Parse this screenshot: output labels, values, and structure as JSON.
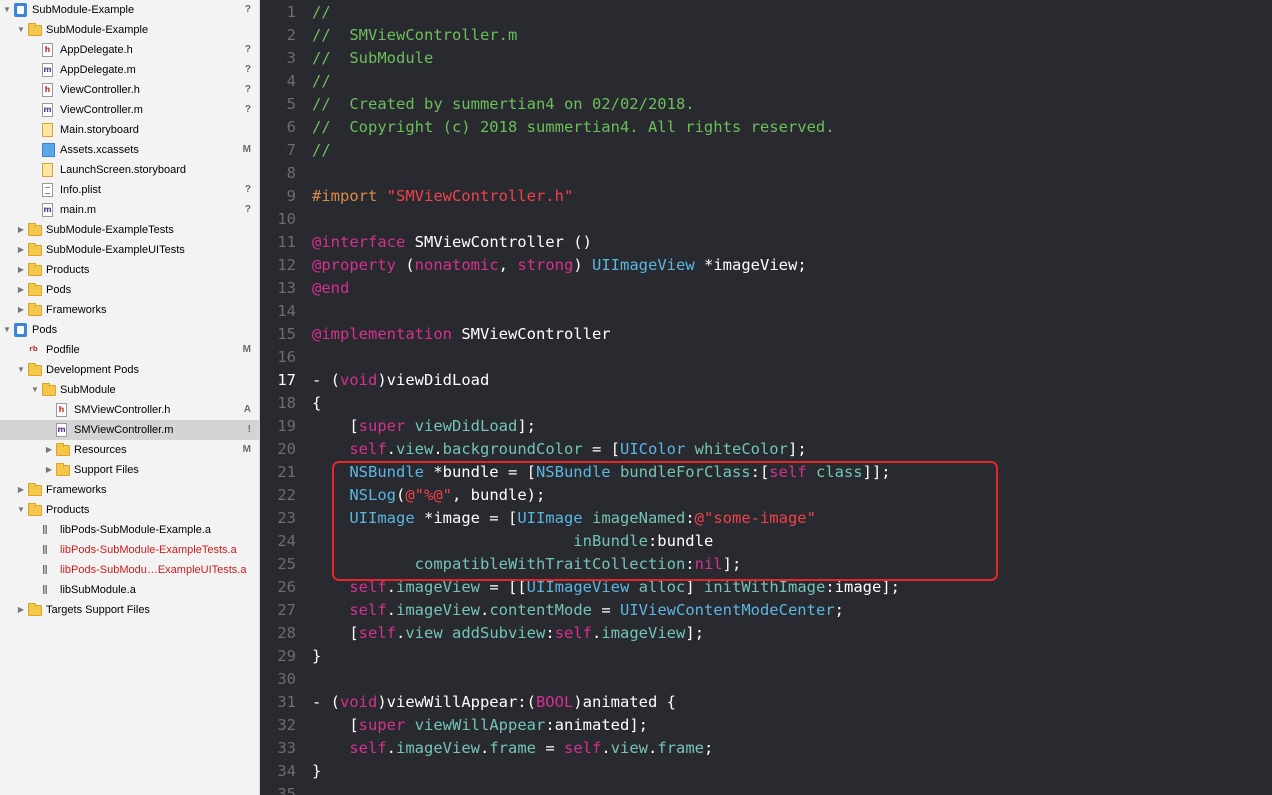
{
  "navigator": {
    "items": [
      {
        "label": "SubModule-Example",
        "depth": 0,
        "icon": "project-icon",
        "disclosure": "open",
        "status": "?"
      },
      {
        "label": "SubModule-Example",
        "depth": 1,
        "icon": "folder-icon",
        "disclosure": "open",
        "status": ""
      },
      {
        "label": "AppDelegate.h",
        "depth": 2,
        "icon": "header-file-icon",
        "disclosure": "",
        "status": "?"
      },
      {
        "label": "AppDelegate.m",
        "depth": 2,
        "icon": "objc-file-icon",
        "disclosure": "",
        "status": "?"
      },
      {
        "label": "ViewController.h",
        "depth": 2,
        "icon": "header-file-icon",
        "disclosure": "",
        "status": "?"
      },
      {
        "label": "ViewController.m",
        "depth": 2,
        "icon": "objc-file-icon",
        "disclosure": "",
        "status": "?"
      },
      {
        "label": "Main.storyboard",
        "depth": 2,
        "icon": "storyboard-icon",
        "disclosure": "",
        "status": ""
      },
      {
        "label": "Assets.xcassets",
        "depth": 2,
        "icon": "asset-catalog-icon",
        "disclosure": "",
        "status": "M"
      },
      {
        "label": "LaunchScreen.storyboard",
        "depth": 2,
        "icon": "storyboard-icon",
        "disclosure": "",
        "status": ""
      },
      {
        "label": "Info.plist",
        "depth": 2,
        "icon": "plist-icon",
        "disclosure": "",
        "status": "?"
      },
      {
        "label": "main.m",
        "depth": 2,
        "icon": "objc-file-icon",
        "disclosure": "",
        "status": "?"
      },
      {
        "label": "SubModule-ExampleTests",
        "depth": 1,
        "icon": "folder-icon",
        "disclosure": "closed",
        "status": ""
      },
      {
        "label": "SubModule-ExampleUITests",
        "depth": 1,
        "icon": "folder-icon",
        "disclosure": "closed",
        "status": ""
      },
      {
        "label": "Products",
        "depth": 1,
        "icon": "folder-icon",
        "disclosure": "closed",
        "status": ""
      },
      {
        "label": "Pods",
        "depth": 1,
        "icon": "folder-icon",
        "disclosure": "closed",
        "status": ""
      },
      {
        "label": "Frameworks",
        "depth": 1,
        "icon": "folder-icon",
        "disclosure": "closed",
        "status": ""
      },
      {
        "label": "Pods",
        "depth": 0,
        "icon": "project-icon",
        "disclosure": "open",
        "status": ""
      },
      {
        "label": "Podfile",
        "depth": 1,
        "icon": "ruby-file-icon",
        "disclosure": "",
        "status": "M"
      },
      {
        "label": "Development Pods",
        "depth": 1,
        "icon": "folder-icon",
        "disclosure": "open",
        "status": ""
      },
      {
        "label": "SubModule",
        "depth": 2,
        "icon": "folder-icon",
        "disclosure": "open",
        "status": ""
      },
      {
        "label": "SMViewController.h",
        "depth": 3,
        "icon": "header-file-icon",
        "disclosure": "",
        "status": "A"
      },
      {
        "label": "SMViewController.m",
        "depth": 3,
        "icon": "objc-file-icon",
        "disclosure": "",
        "status": "!",
        "selected": true
      },
      {
        "label": "Resources",
        "depth": 3,
        "icon": "folder-icon",
        "disclosure": "closed",
        "status": "M"
      },
      {
        "label": "Support Files",
        "depth": 3,
        "icon": "folder-icon",
        "disclosure": "closed",
        "status": ""
      },
      {
        "label": "Frameworks",
        "depth": 1,
        "icon": "folder-icon",
        "disclosure": "closed",
        "status": ""
      },
      {
        "label": "Products",
        "depth": 1,
        "icon": "folder-icon",
        "disclosure": "open",
        "status": ""
      },
      {
        "label": "libPods-SubModule-Example.a",
        "depth": 2,
        "icon": "library-icon",
        "disclosure": "",
        "status": ""
      },
      {
        "label": "libPods-SubModule-ExampleTests.a",
        "depth": 2,
        "icon": "library-icon",
        "disclosure": "",
        "status": "",
        "missing": true
      },
      {
        "label": "libPods-SubModu…ExampleUITests.a",
        "depth": 2,
        "icon": "library-icon",
        "disclosure": "",
        "status": "",
        "missing": true
      },
      {
        "label": "libSubModule.a",
        "depth": 2,
        "icon": "library-icon",
        "disclosure": "",
        "status": ""
      },
      {
        "label": "Targets Support Files",
        "depth": 1,
        "icon": "folder-icon",
        "disclosure": "closed",
        "status": ""
      }
    ]
  },
  "editor": {
    "current_line": 17,
    "lines": [
      {
        "n": "1",
        "tokens": [
          [
            "//",
            "c"
          ]
        ]
      },
      {
        "n": "2",
        "tokens": [
          [
            "//  SMViewController.m",
            "c"
          ]
        ]
      },
      {
        "n": "3",
        "tokens": [
          [
            "//  SubModule",
            "c"
          ]
        ]
      },
      {
        "n": "4",
        "tokens": [
          [
            "//",
            "c"
          ]
        ]
      },
      {
        "n": "5",
        "tokens": [
          [
            "//  Created by summertian4 on 02/02/2018.",
            "c"
          ]
        ]
      },
      {
        "n": "6",
        "tokens": [
          [
            "//  Copyright (c) 2018 summertian4. All rights reserved.",
            "c"
          ]
        ]
      },
      {
        "n": "7",
        "tokens": [
          [
            "//",
            "c"
          ]
        ]
      },
      {
        "n": "8",
        "tokens": []
      },
      {
        "n": "9",
        "tokens": [
          [
            "#import ",
            "p"
          ],
          [
            "\"SMViewController.h\"",
            "s"
          ]
        ]
      },
      {
        "n": "10",
        "tokens": []
      },
      {
        "n": "11",
        "tokens": [
          [
            "@interface",
            "k"
          ],
          [
            " SMViewController ()",
            "w"
          ]
        ]
      },
      {
        "n": "12",
        "tokens": [
          [
            "@property",
            "k"
          ],
          [
            " (",
            "w"
          ],
          [
            "nonatomic",
            "k"
          ],
          [
            ", ",
            "w"
          ],
          [
            "strong",
            "k"
          ],
          [
            ") ",
            "w"
          ],
          [
            "UIImageView",
            "t"
          ],
          [
            " *imageView;",
            "w"
          ]
        ]
      },
      {
        "n": "13",
        "tokens": [
          [
            "@end",
            "k"
          ]
        ]
      },
      {
        "n": "14",
        "tokens": []
      },
      {
        "n": "15",
        "tokens": [
          [
            "@implementation",
            "k"
          ],
          [
            " SMViewController",
            "w"
          ]
        ]
      },
      {
        "n": "16",
        "tokens": []
      },
      {
        "n": "17",
        "tokens": [
          [
            "- (",
            "w"
          ],
          [
            "void",
            "k"
          ],
          [
            ")viewDidLoad",
            "w"
          ]
        ]
      },
      {
        "n": "18",
        "tokens": [
          [
            "{",
            "w"
          ]
        ]
      },
      {
        "n": "19",
        "tokens": [
          [
            "    [",
            "w"
          ],
          [
            "super",
            "k"
          ],
          [
            " ",
            "w"
          ],
          [
            "viewDidLoad",
            "m"
          ],
          [
            "];",
            "w"
          ]
        ]
      },
      {
        "n": "20",
        "tokens": [
          [
            "    ",
            "w"
          ],
          [
            "self",
            "k"
          ],
          [
            ".",
            "w"
          ],
          [
            "view",
            "m"
          ],
          [
            ".",
            "w"
          ],
          [
            "backgroundColor",
            "m"
          ],
          [
            " = [",
            "w"
          ],
          [
            "UIColor",
            "t"
          ],
          [
            " ",
            "w"
          ],
          [
            "whiteColor",
            "m"
          ],
          [
            "];",
            "w"
          ]
        ]
      },
      {
        "n": "21",
        "tokens": [
          [
            "    ",
            "w"
          ],
          [
            "NSBundle",
            "t"
          ],
          [
            " *bundle = [",
            "w"
          ],
          [
            "NSBundle",
            "t"
          ],
          [
            " ",
            "w"
          ],
          [
            "bundleForClass",
            "m"
          ],
          [
            ":[",
            "w"
          ],
          [
            "self",
            "k"
          ],
          [
            " ",
            "w"
          ],
          [
            "class",
            "m"
          ],
          [
            "]];",
            "w"
          ]
        ]
      },
      {
        "n": "22",
        "tokens": [
          [
            "    ",
            "w"
          ],
          [
            "NSLog",
            "t"
          ],
          [
            "(",
            "w"
          ],
          [
            "@\"%@\"",
            "s"
          ],
          [
            ", bundle);",
            "w"
          ]
        ]
      },
      {
        "n": "23",
        "tokens": [
          [
            "    ",
            "w"
          ],
          [
            "UIImage",
            "t"
          ],
          [
            " *image = [",
            "w"
          ],
          [
            "UIImage",
            "t"
          ],
          [
            " ",
            "w"
          ],
          [
            "imageNamed",
            "m"
          ],
          [
            ":",
            "w"
          ],
          [
            "@\"some-image\"",
            "s"
          ]
        ]
      },
      {
        "n": "24",
        "tokens": [
          [
            "                            ",
            "w"
          ],
          [
            "inBundle",
            "m"
          ],
          [
            ":bundle",
            "w"
          ]
        ]
      },
      {
        "n": "25",
        "tokens": [
          [
            "           ",
            "w"
          ],
          [
            "compatibleWithTraitCollection",
            "m"
          ],
          [
            ":",
            "w"
          ],
          [
            "nil",
            "k"
          ],
          [
            "];",
            "w"
          ]
        ]
      },
      {
        "n": "26",
        "tokens": [
          [
            "    ",
            "w"
          ],
          [
            "self",
            "k"
          ],
          [
            ".",
            "w"
          ],
          [
            "imageView",
            "m"
          ],
          [
            " = [[",
            "w"
          ],
          [
            "UIImageView",
            "t"
          ],
          [
            " ",
            "w"
          ],
          [
            "alloc",
            "m"
          ],
          [
            "] ",
            "w"
          ],
          [
            "initWithImage",
            "m"
          ],
          [
            ":image];",
            "w"
          ]
        ]
      },
      {
        "n": "27",
        "tokens": [
          [
            "    ",
            "w"
          ],
          [
            "self",
            "k"
          ],
          [
            ".",
            "w"
          ],
          [
            "imageView",
            "m"
          ],
          [
            ".",
            "w"
          ],
          [
            "contentMode",
            "m"
          ],
          [
            " = ",
            "w"
          ],
          [
            "UIViewContentModeCenter",
            "t"
          ],
          [
            ";",
            "w"
          ]
        ]
      },
      {
        "n": "28",
        "tokens": [
          [
            "    [",
            "w"
          ],
          [
            "self",
            "k"
          ],
          [
            ".",
            "w"
          ],
          [
            "view",
            "m"
          ],
          [
            " ",
            "w"
          ],
          [
            "addSubview",
            "m"
          ],
          [
            ":",
            "w"
          ],
          [
            "self",
            "k"
          ],
          [
            ".",
            "w"
          ],
          [
            "imageView",
            "m"
          ],
          [
            "];",
            "w"
          ]
        ]
      },
      {
        "n": "29",
        "tokens": [
          [
            "}",
            "w"
          ]
        ]
      },
      {
        "n": "30",
        "tokens": []
      },
      {
        "n": "31",
        "tokens": [
          [
            "- (",
            "w"
          ],
          [
            "void",
            "k"
          ],
          [
            ")viewWillAppear:(",
            "w"
          ],
          [
            "BOOL",
            "k"
          ],
          [
            ")animated {",
            "w"
          ]
        ]
      },
      {
        "n": "32",
        "tokens": [
          [
            "    [",
            "w"
          ],
          [
            "super",
            "k"
          ],
          [
            " ",
            "w"
          ],
          [
            "viewWillAppear",
            "m"
          ],
          [
            ":animated];",
            "w"
          ]
        ]
      },
      {
        "n": "33",
        "tokens": [
          [
            "    ",
            "w"
          ],
          [
            "self",
            "k"
          ],
          [
            ".",
            "w"
          ],
          [
            "imageView",
            "m"
          ],
          [
            ".",
            "w"
          ],
          [
            "frame",
            "m"
          ],
          [
            " = ",
            "w"
          ],
          [
            "self",
            "k"
          ],
          [
            ".",
            "w"
          ],
          [
            "view",
            "m"
          ],
          [
            ".",
            "w"
          ],
          [
            "frame",
            "m"
          ],
          [
            ";",
            "w"
          ]
        ]
      },
      {
        "n": "34",
        "tokens": [
          [
            "}",
            "w"
          ]
        ]
      },
      {
        "n": "35",
        "tokens": []
      }
    ]
  },
  "colors": {
    "editor_background": "#292a30",
    "comment": "#6bbf59",
    "keyword": "#d6308f",
    "string": "#f0414a",
    "type": "#5ab6e0",
    "method": "#73c4b4",
    "preprocessor": "#d98b4a",
    "annotation_box": "#e3262a"
  }
}
